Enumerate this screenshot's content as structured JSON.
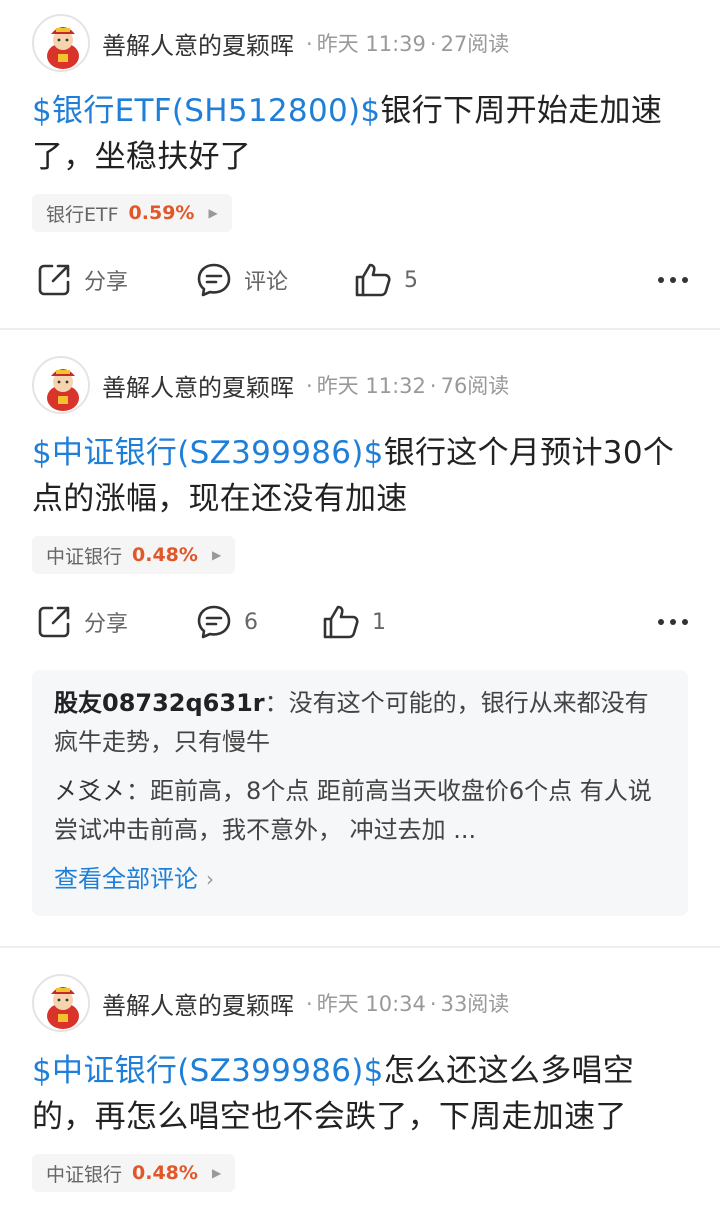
{
  "posts": [
    {
      "author": "善解人意的夏颖晖",
      "time": "昨天 11:39",
      "reads": "27阅读",
      "stock_link": "$银行ETF(SH512800)$",
      "text": "银行下周开始走加速了，坐稳扶好了",
      "tag": {
        "name": "银行ETF",
        "pct": "0.59%"
      },
      "actions": {
        "share": "分享",
        "comment": "评论",
        "like": "5"
      }
    },
    {
      "author": "善解人意的夏颖晖",
      "time": "昨天 11:32",
      "reads": "76阅读",
      "stock_link": "$中证银行(SZ399986)$",
      "text": "银行这个月预计30个点的涨幅，现在还没有加速",
      "tag": {
        "name": "中证银行",
        "pct": "0.48%"
      },
      "actions": {
        "share": "分享",
        "comment": "6",
        "like": "1"
      },
      "comments": [
        {
          "name": "股友08732q631r",
          "sep": "：",
          "text": "没有这个可能的，银行从来都没有疯牛走势，只有慢牛"
        },
        {
          "name": "㐅爻㐅",
          "sep": "：",
          "text": "距前高，8个点  距前高当天收盘价6个点  有人说尝试冲击前高，我不意外，  冲过去加 ..."
        }
      ],
      "view_all": "查看全部评论"
    },
    {
      "author": "善解人意的夏颖晖",
      "time": "昨天 10:34",
      "reads": "33阅读",
      "stock_link": "$中证银行(SZ399986)$",
      "text": "怎么还这么多唱空的，再怎么唱空也不会跌了，下周走加速了",
      "tag": {
        "name": "中证银行",
        "pct": "0.48%"
      }
    }
  ],
  "colors": {
    "link": "#1f7fd8",
    "pct_up": "#e0572a",
    "meta": "#999999"
  },
  "icons": {
    "share": "share-icon",
    "comment": "comment-icon",
    "like": "thumbs-up-icon",
    "more": "more-icon"
  }
}
